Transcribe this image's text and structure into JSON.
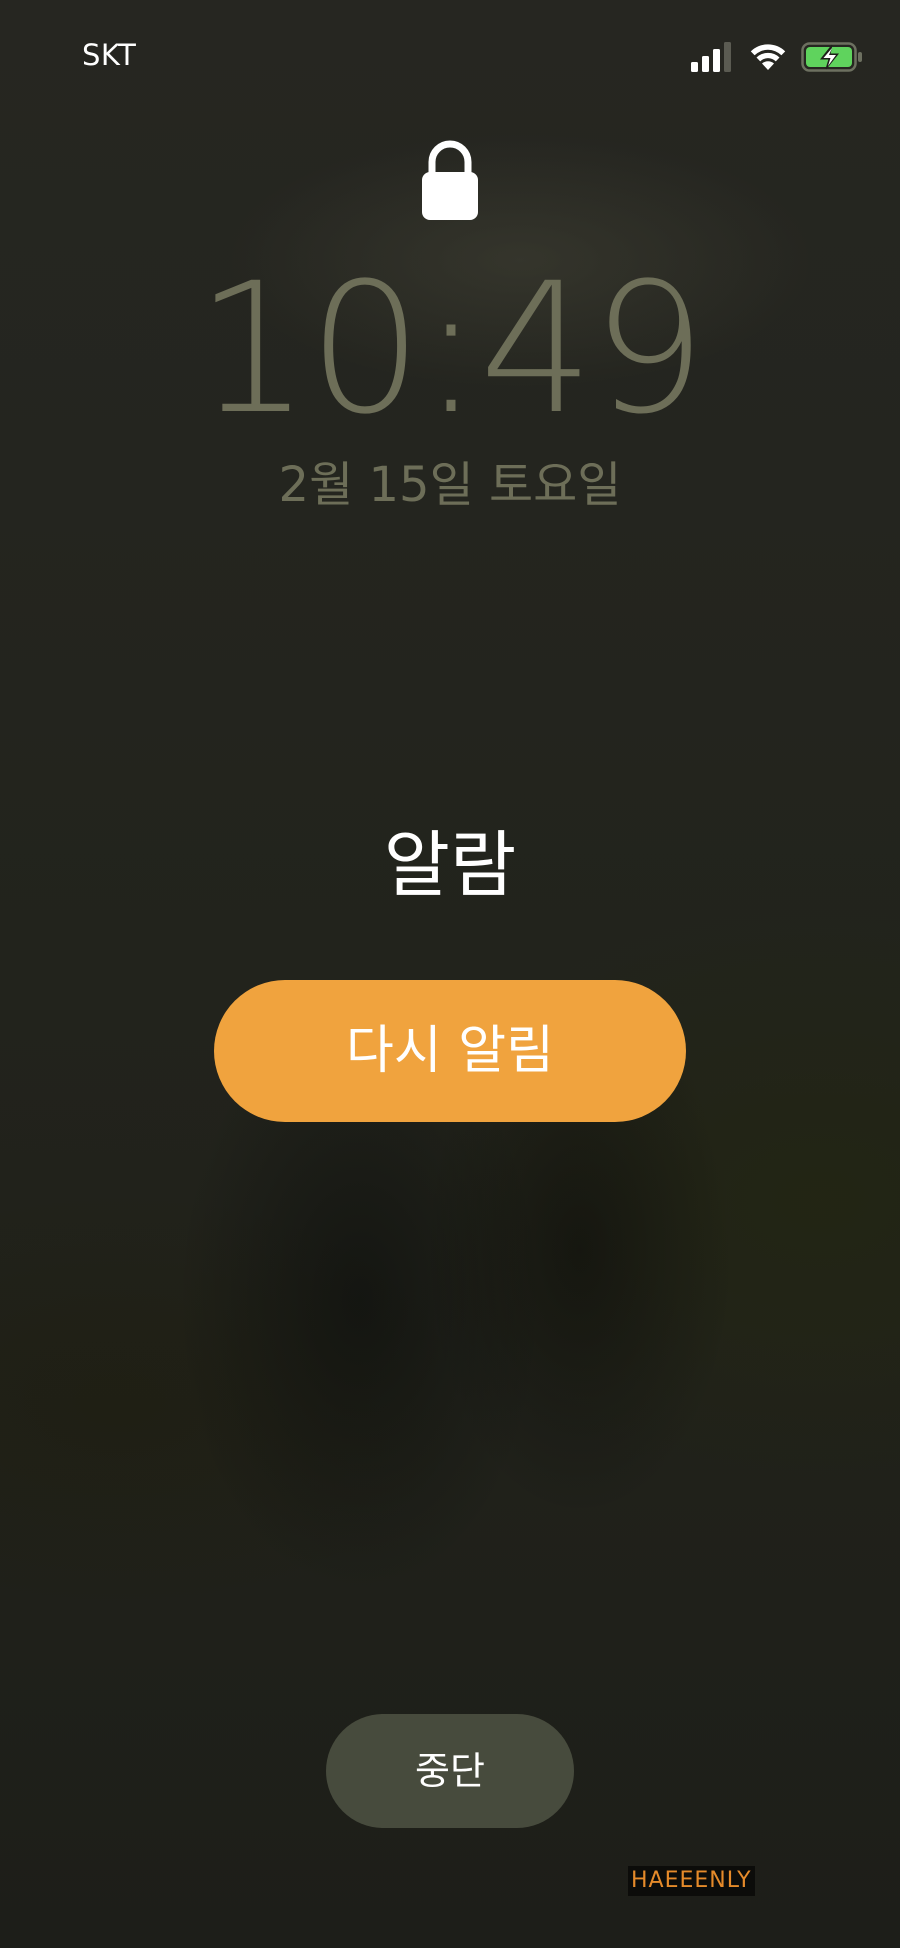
{
  "status_bar": {
    "carrier": "SKT",
    "signal_bars_active": 3,
    "signal_bars_total": 4,
    "battery_charging": true,
    "icons": [
      "signal-icon",
      "wifi-icon",
      "battery-charging-icon"
    ],
    "battery_color": "#5fd35d"
  },
  "lock_screen": {
    "lock_icon": "lock-icon",
    "time": "10:49",
    "date": "2월 15일 토요일",
    "text_color": "#6d6e58"
  },
  "alarm": {
    "title": "알람",
    "snooze_label": "다시 알림",
    "snooze_color": "#f0a33e",
    "stop_label": "중단",
    "stop_color": "#474b3d"
  },
  "watermark": {
    "text": "HAEEENLY",
    "color": "#e58a2a"
  }
}
